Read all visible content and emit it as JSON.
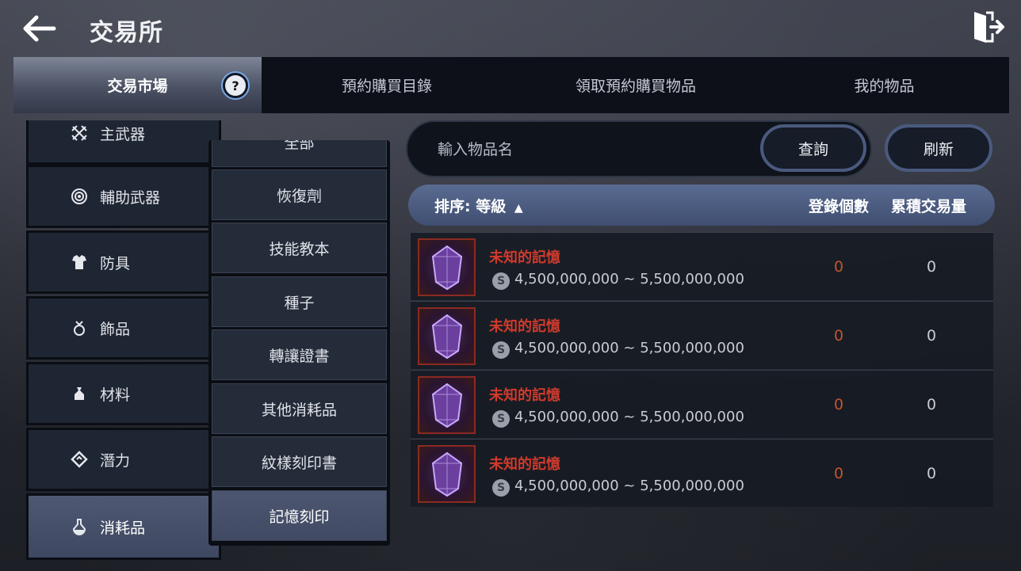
{
  "header": {
    "title": "交易所",
    "back_icon": "arrow-left-icon",
    "exit_icon": "exit-door-icon"
  },
  "tabs": [
    {
      "label": "交易市場",
      "active": true
    },
    {
      "label": "預約購買目錄",
      "active": false
    },
    {
      "label": "領取預約購買物品",
      "active": false
    },
    {
      "label": "我的物品",
      "active": false
    }
  ],
  "help_icon_glyph": "?",
  "categories": [
    {
      "label": "主武器",
      "icon": "swords-icon"
    },
    {
      "label": "輔助武器",
      "icon": "target-icon"
    },
    {
      "label": "防具",
      "icon": "armor-icon"
    },
    {
      "label": "飾品",
      "icon": "ring-icon"
    },
    {
      "label": "材料",
      "icon": "pouch-icon"
    },
    {
      "label": "潛力",
      "icon": "diamond-icon"
    },
    {
      "label": "消耗品",
      "icon": "potion-icon",
      "active": true
    }
  ],
  "subcategories": [
    {
      "label": "全部"
    },
    {
      "label": "恢復劑"
    },
    {
      "label": "技能教本"
    },
    {
      "label": "種子"
    },
    {
      "label": "轉讓證書"
    },
    {
      "label": "其他消耗品"
    },
    {
      "label": "紋樣刻印書"
    },
    {
      "label": "記憶刻印",
      "active": true
    }
  ],
  "search": {
    "placeholder": "輸入物品名",
    "query_label": "查詢",
    "refresh_label": "刷新"
  },
  "sort": {
    "label": "排序: 等級",
    "arrow": "▲",
    "col_count": "登錄個數",
    "col_volume": "累積交易量"
  },
  "items": [
    {
      "name": "未知的記憶",
      "coin": "S",
      "price": "4,500,000,000 ~ 5,500,000,000",
      "count": "0",
      "volume": "0"
    },
    {
      "name": "未知的記憶",
      "coin": "S",
      "price": "4,500,000,000 ~ 5,500,000,000",
      "count": "0",
      "volume": "0"
    },
    {
      "name": "未知的記憶",
      "coin": "S",
      "price": "4,500,000,000 ~ 5,500,000,000",
      "count": "0",
      "volume": "0"
    },
    {
      "name": "未知的記憶",
      "coin": "S",
      "price": "4,500,000,000 ~ 5,500,000,000",
      "count": "0",
      "volume": "0"
    }
  ],
  "colors": {
    "item_name": "#d03a2c",
    "count_value": "#c0552e",
    "sort_bar": "#4f5f85",
    "active_category": "#4a536c"
  }
}
